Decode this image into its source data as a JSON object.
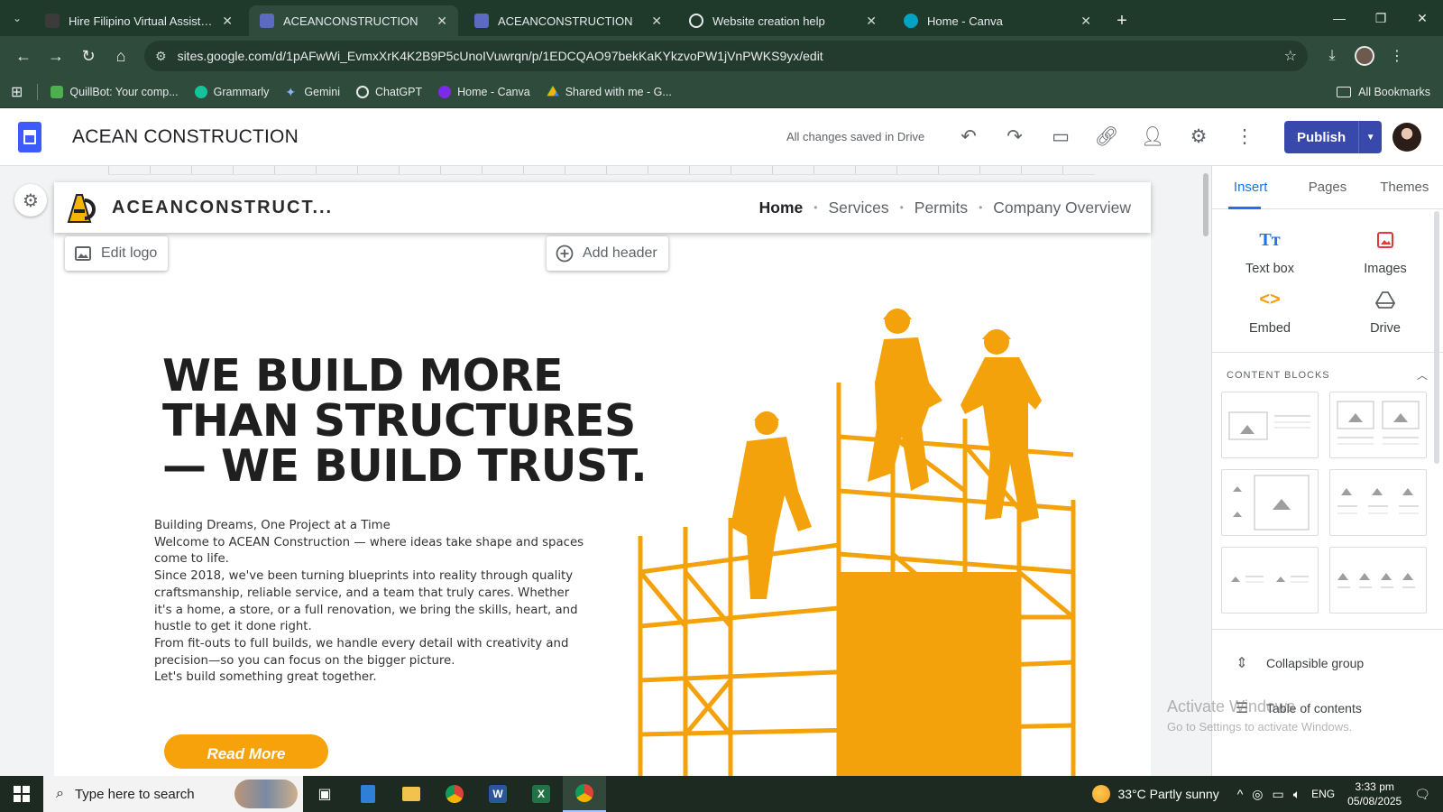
{
  "browser": {
    "tabs": [
      {
        "title": "Hire Filipino Virtual Assistants |",
        "active": false,
        "icon": "n-logo-icon"
      },
      {
        "title": "ACEANCONSTRUCTION",
        "active": true,
        "icon": "google-sites-icon"
      },
      {
        "title": "ACEANCONSTRUCTION",
        "active": false,
        "icon": "google-sites-icon"
      },
      {
        "title": "Website creation help",
        "active": false,
        "icon": "chatgpt-icon"
      },
      {
        "title": "Home - Canva",
        "active": false,
        "icon": "canva-icon"
      }
    ],
    "url": "sites.google.com/d/1pAFwWi_EvmxXrK4K2B9P5cUnoIVuwrqn/p/1EDCQAO97bekKaKYkzvoPW1jVnPWKS9yx/edit",
    "bookmarks": [
      "QuillBot: Your comp...",
      "Grammarly",
      "Gemini",
      "ChatGPT",
      "Home - Canva",
      "Shared with me - G..."
    ],
    "all_bookmarks": "All Bookmarks"
  },
  "sites": {
    "doc_title": "ACEAN CONSTRUCTION",
    "save_status": "All changes saved in Drive",
    "publish_label": "Publish"
  },
  "site": {
    "brand": "ACEANCONSTRUCT...",
    "nav": [
      "Home",
      "Services",
      "Permits",
      "Company Overview"
    ],
    "edit_logo": "Edit logo",
    "add_header": "Add header",
    "hero_title": "WE BUILD MORE THAN STRUCTURES — WE BUILD TRUST.",
    "body": [
      "Building Dreams, One Project at a Time",
      "Welcome to ACEAN Construction — where ideas take shape and spaces come to life.",
      "Since 2018, we've been turning blueprints into reality through quality craftsmanship, reliable service, and a team that truly cares. Whether it's a home, a store, or a full renovation, we bring the skills, heart, and hustle to get it done right.",
      "From fit-outs to full builds, we handle every detail with creativity and precision—so you can focus on the bigger picture.",
      "Let's build something great together."
    ],
    "cta": "Read More"
  },
  "panel": {
    "tabs": [
      "Insert",
      "Pages",
      "Themes"
    ],
    "insert_items": [
      {
        "label": "Text box",
        "icon": "text-box-icon"
      },
      {
        "label": "Images",
        "icon": "image-icon"
      },
      {
        "label": "Embed",
        "icon": "embed-icon"
      },
      {
        "label": "Drive",
        "icon": "drive-icon"
      }
    ],
    "content_blocks_label": "CONTENT BLOCKS",
    "list": [
      "Collapsible group",
      "Table of contents"
    ]
  },
  "watermark": {
    "line1": "Activate Windows",
    "line2": "Go to Settings to activate Windows."
  },
  "taskbar": {
    "search_placeholder": "Type here to search",
    "weather": "33°C  Partly sunny",
    "lang": "ENG",
    "time": "3:33 pm",
    "date": "05/08/2025"
  },
  "colors": {
    "accent": "#f7a20b",
    "publish": "#3949ab",
    "chrome": "#2f4b3c"
  }
}
